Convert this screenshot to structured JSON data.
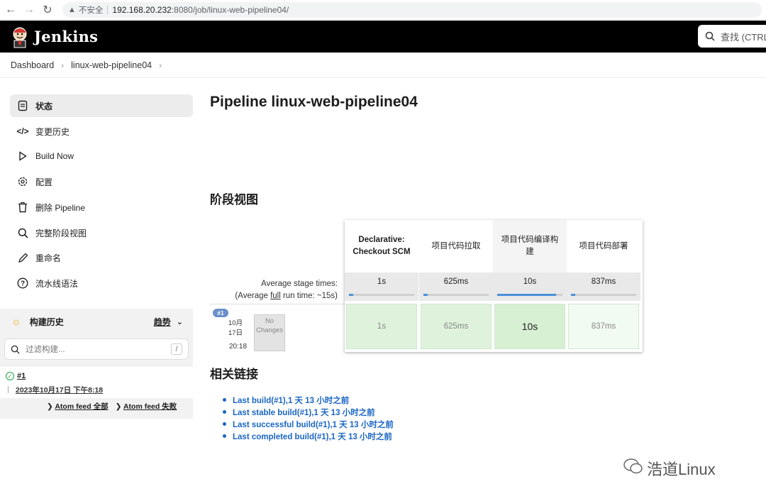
{
  "browser": {
    "insecure_label": "不安全",
    "url_host": "192.168.20.232",
    "url_path": ":8080/job/linux-web-pipeline04/"
  },
  "header": {
    "brand": "Jenkins",
    "search_placeholder": "查找 (CTRL"
  },
  "breadcrumb": {
    "items": [
      "Dashboard",
      "linux-web-pipeline04"
    ]
  },
  "sidebar": {
    "tasks": [
      {
        "label": "状态",
        "icon": "notepad-icon"
      },
      {
        "label": "变更历史",
        "icon": "code-icon"
      },
      {
        "label": "Build Now",
        "icon": "play-icon"
      },
      {
        "label": "配置",
        "icon": "gear-icon"
      },
      {
        "label": "删除 Pipeline",
        "icon": "trash-icon"
      },
      {
        "label": "完整阶段视图",
        "icon": "search-icon"
      },
      {
        "label": "重命名",
        "icon": "pencil-icon"
      },
      {
        "label": "流水线语法",
        "icon": "help-icon"
      }
    ],
    "history": {
      "title": "构建历史",
      "trend": "趋势",
      "filter_placeholder": "过滤构建...",
      "filter_shortcut": "/",
      "builds": [
        {
          "number": "#1",
          "date": "2023年10月17日 下午8:18"
        }
      ],
      "feed_all": "Atom feed 全部",
      "feed_failed": "Atom feed 失败"
    }
  },
  "main": {
    "title": "Pipeline linux-web-pipeline04",
    "stage_view_title": "阶段视图",
    "avg_stage_label": "Average stage times:",
    "avg_full_prefix": "(Average ",
    "avg_full_link": "full",
    "avg_full_suffix": " run time: ~15s)",
    "build": {
      "badge": "#1",
      "month": "10月",
      "day": "17日",
      "time": "20:18",
      "no_changes_1": "No",
      "no_changes_2": "Changes"
    },
    "stages": [
      {
        "name": "Declarative: Checkout SCM",
        "avg": "1s",
        "avg_fraction": 0.07,
        "run": "1s"
      },
      {
        "name": "项目代码拉取",
        "avg": "625ms",
        "avg_fraction": 0.06,
        "run": "625ms"
      },
      {
        "name": "项目代码编译构建",
        "avg": "10s",
        "avg_fraction": 0.9,
        "run": "10s"
      },
      {
        "name": "项目代码部署",
        "avg": "837ms",
        "avg_fraction": 0.06,
        "run": "837ms"
      }
    ],
    "related_title": "相关链接",
    "links": [
      "Last build(#1),1 天 13 小时之前",
      "Last stable build(#1),1 天 13 小时之前",
      "Last successful build(#1),1 天 13 小时之前",
      "Last completed build(#1),1 天 13 小时之前"
    ]
  },
  "watermark": "浩道Linux",
  "colors": {
    "accent_link": "#1a66c4",
    "stage_success": "#dff3dc",
    "avg_bar": "#4a90d9"
  }
}
